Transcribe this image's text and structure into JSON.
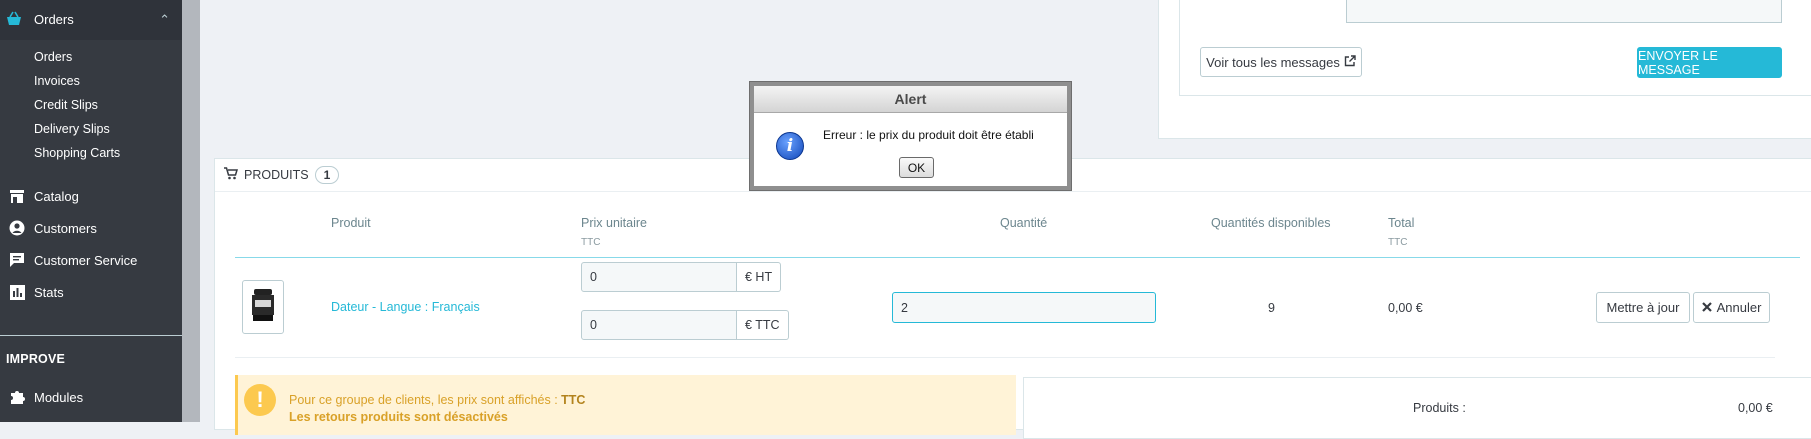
{
  "sidebar": {
    "orders_section": "Orders",
    "sub_items": [
      "Orders",
      "Invoices",
      "Credit Slips",
      "Delivery Slips",
      "Shopping Carts"
    ],
    "items": [
      "Catalog",
      "Customers",
      "Customer Service",
      "Stats"
    ],
    "improve_label": "IMPROVE",
    "modules_label": "Modules"
  },
  "messages": {
    "view_all_label": "Voir tous les messages",
    "send_label": "ENVOYER LE MESSAGE"
  },
  "products": {
    "title": "PRODUITS",
    "count": "1",
    "headers": {
      "product": "Produit",
      "unit_price": "Prix unitaire",
      "unit_price_sub": "TTC",
      "quantity": "Quantité",
      "available": "Quantités disponibles",
      "total": "Total",
      "total_sub": "TTC"
    },
    "row": {
      "name": "Dateur - Langue : Français",
      "price_ht": "0",
      "price_ht_unit": "€ HT",
      "price_ttc": "0",
      "price_ttc_unit": "€ TTC",
      "quantity": "2",
      "available": "9",
      "total": "0,00 €",
      "update_label": "Mettre à jour",
      "cancel_label": "Annuler"
    }
  },
  "warning": {
    "line1_prefix": "Pour ce groupe de clients, les prix sont affichés :",
    "line1_value": "TTC",
    "line2": "Les retours produits sont désactivés"
  },
  "totals": {
    "products_label": "Produits :",
    "products_value": "0,00 €"
  },
  "alert": {
    "title": "Alert",
    "message": "Erreur : le prix du produit doit être établi",
    "ok_label": "OK"
  },
  "colors": {
    "sidebar_bg": "#363a41",
    "accent": "#25b9d7",
    "warning_bg": "#fff3d7",
    "warning_icon": "#fcc94f"
  }
}
